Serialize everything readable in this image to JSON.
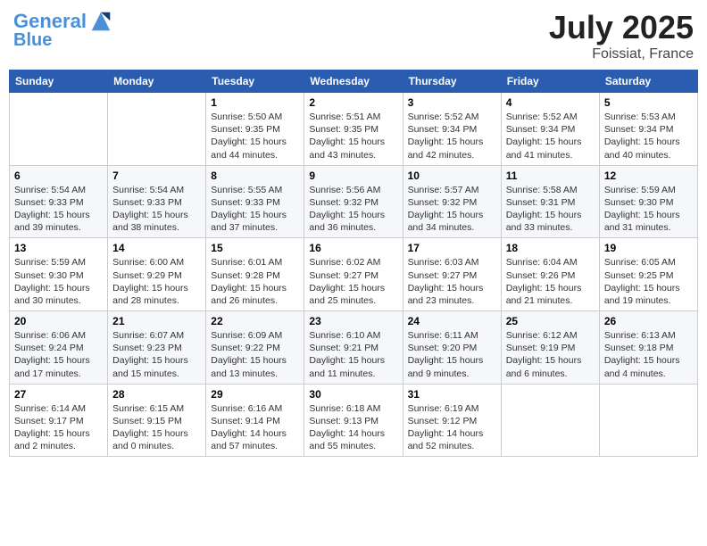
{
  "header": {
    "logo_line1": "General",
    "logo_line2": "Blue",
    "month_title": "July 2025",
    "location": "Foissiat, France"
  },
  "days_of_week": [
    "Sunday",
    "Monday",
    "Tuesday",
    "Wednesday",
    "Thursday",
    "Friday",
    "Saturday"
  ],
  "weeks": [
    [
      {
        "day": "",
        "info": ""
      },
      {
        "day": "",
        "info": ""
      },
      {
        "day": "1",
        "info": "Sunrise: 5:50 AM\nSunset: 9:35 PM\nDaylight: 15 hours\nand 44 minutes."
      },
      {
        "day": "2",
        "info": "Sunrise: 5:51 AM\nSunset: 9:35 PM\nDaylight: 15 hours\nand 43 minutes."
      },
      {
        "day": "3",
        "info": "Sunrise: 5:52 AM\nSunset: 9:34 PM\nDaylight: 15 hours\nand 42 minutes."
      },
      {
        "day": "4",
        "info": "Sunrise: 5:52 AM\nSunset: 9:34 PM\nDaylight: 15 hours\nand 41 minutes."
      },
      {
        "day": "5",
        "info": "Sunrise: 5:53 AM\nSunset: 9:34 PM\nDaylight: 15 hours\nand 40 minutes."
      }
    ],
    [
      {
        "day": "6",
        "info": "Sunrise: 5:54 AM\nSunset: 9:33 PM\nDaylight: 15 hours\nand 39 minutes."
      },
      {
        "day": "7",
        "info": "Sunrise: 5:54 AM\nSunset: 9:33 PM\nDaylight: 15 hours\nand 38 minutes."
      },
      {
        "day": "8",
        "info": "Sunrise: 5:55 AM\nSunset: 9:33 PM\nDaylight: 15 hours\nand 37 minutes."
      },
      {
        "day": "9",
        "info": "Sunrise: 5:56 AM\nSunset: 9:32 PM\nDaylight: 15 hours\nand 36 minutes."
      },
      {
        "day": "10",
        "info": "Sunrise: 5:57 AM\nSunset: 9:32 PM\nDaylight: 15 hours\nand 34 minutes."
      },
      {
        "day": "11",
        "info": "Sunrise: 5:58 AM\nSunset: 9:31 PM\nDaylight: 15 hours\nand 33 minutes."
      },
      {
        "day": "12",
        "info": "Sunrise: 5:59 AM\nSunset: 9:30 PM\nDaylight: 15 hours\nand 31 minutes."
      }
    ],
    [
      {
        "day": "13",
        "info": "Sunrise: 5:59 AM\nSunset: 9:30 PM\nDaylight: 15 hours\nand 30 minutes."
      },
      {
        "day": "14",
        "info": "Sunrise: 6:00 AM\nSunset: 9:29 PM\nDaylight: 15 hours\nand 28 minutes."
      },
      {
        "day": "15",
        "info": "Sunrise: 6:01 AM\nSunset: 9:28 PM\nDaylight: 15 hours\nand 26 minutes."
      },
      {
        "day": "16",
        "info": "Sunrise: 6:02 AM\nSunset: 9:27 PM\nDaylight: 15 hours\nand 25 minutes."
      },
      {
        "day": "17",
        "info": "Sunrise: 6:03 AM\nSunset: 9:27 PM\nDaylight: 15 hours\nand 23 minutes."
      },
      {
        "day": "18",
        "info": "Sunrise: 6:04 AM\nSunset: 9:26 PM\nDaylight: 15 hours\nand 21 minutes."
      },
      {
        "day": "19",
        "info": "Sunrise: 6:05 AM\nSunset: 9:25 PM\nDaylight: 15 hours\nand 19 minutes."
      }
    ],
    [
      {
        "day": "20",
        "info": "Sunrise: 6:06 AM\nSunset: 9:24 PM\nDaylight: 15 hours\nand 17 minutes."
      },
      {
        "day": "21",
        "info": "Sunrise: 6:07 AM\nSunset: 9:23 PM\nDaylight: 15 hours\nand 15 minutes."
      },
      {
        "day": "22",
        "info": "Sunrise: 6:09 AM\nSunset: 9:22 PM\nDaylight: 15 hours\nand 13 minutes."
      },
      {
        "day": "23",
        "info": "Sunrise: 6:10 AM\nSunset: 9:21 PM\nDaylight: 15 hours\nand 11 minutes."
      },
      {
        "day": "24",
        "info": "Sunrise: 6:11 AM\nSunset: 9:20 PM\nDaylight: 15 hours\nand 9 minutes."
      },
      {
        "day": "25",
        "info": "Sunrise: 6:12 AM\nSunset: 9:19 PM\nDaylight: 15 hours\nand 6 minutes."
      },
      {
        "day": "26",
        "info": "Sunrise: 6:13 AM\nSunset: 9:18 PM\nDaylight: 15 hours\nand 4 minutes."
      }
    ],
    [
      {
        "day": "27",
        "info": "Sunrise: 6:14 AM\nSunset: 9:17 PM\nDaylight: 15 hours\nand 2 minutes."
      },
      {
        "day": "28",
        "info": "Sunrise: 6:15 AM\nSunset: 9:15 PM\nDaylight: 15 hours\nand 0 minutes."
      },
      {
        "day": "29",
        "info": "Sunrise: 6:16 AM\nSunset: 9:14 PM\nDaylight: 14 hours\nand 57 minutes."
      },
      {
        "day": "30",
        "info": "Sunrise: 6:18 AM\nSunset: 9:13 PM\nDaylight: 14 hours\nand 55 minutes."
      },
      {
        "day": "31",
        "info": "Sunrise: 6:19 AM\nSunset: 9:12 PM\nDaylight: 14 hours\nand 52 minutes."
      },
      {
        "day": "",
        "info": ""
      },
      {
        "day": "",
        "info": ""
      }
    ]
  ]
}
